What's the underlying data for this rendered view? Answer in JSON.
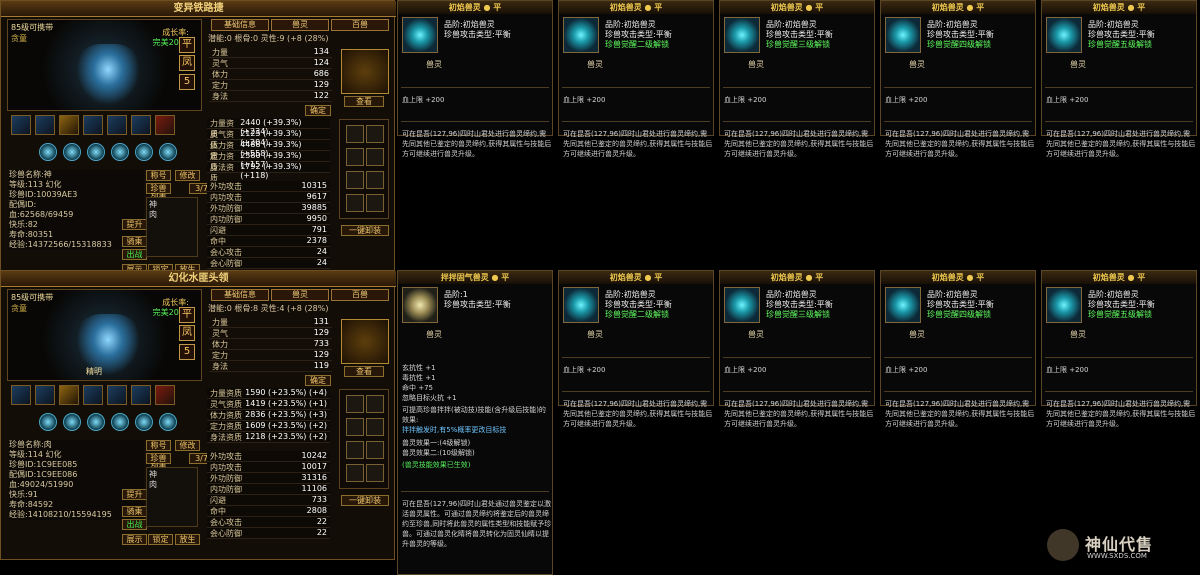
{
  "panels": [
    {
      "title": "变异铁路捷",
      "carry": "85级可携带",
      "carry_sub": "贪童",
      "growth": "成长率:",
      "growth_value": "完美2035",
      "tabs": [
        "基础信息",
        "兽灵",
        "百兽"
      ],
      "nums": {
        "potential": "潜能:0",
        "bone": "根骨:0",
        "soul": "灵性:9",
        "ratio": "(+8 (28%)"
      },
      "stats": [
        [
          "力量",
          134
        ],
        [
          "灵气",
          124
        ],
        [
          "体力",
          686
        ],
        [
          "定力",
          129
        ],
        [
          "身法",
          122
        ]
      ],
      "attrs": [
        [
          "力量资质",
          "2440 (+39.3%)",
          "(+234)"
        ],
        [
          "灵气资质",
          "2125 (+39.3%)",
          "(+204)"
        ],
        [
          "体力资质",
          "4488 (+39.3%)",
          "(+558)"
        ],
        [
          "定力资质",
          "2380 (+39.3%)",
          "(+157)"
        ],
        [
          "身法资质",
          "1792 (+39.3%)",
          "(+118)"
        ]
      ],
      "combat": [
        [
          "外功攻击",
          10315
        ],
        [
          "内功攻击",
          9617
        ],
        [
          "外功防御",
          39885
        ],
        [
          "内功防御",
          9950
        ],
        [
          "闪避",
          791
        ],
        [
          "命中",
          2378
        ],
        [
          "会心攻击",
          24
        ],
        [
          "会心防御",
          24
        ]
      ],
      "name": "神",
      "level": "等级:113",
      "illusion": "幻化",
      "pet_id": "珍兽ID:10039AE3",
      "mate": "配偶ID:",
      "hp": "血:62568/69459",
      "joy": "快乐:82",
      "life": "寿命:80351",
      "exp": "经验:14372566/15318833",
      "buttons": [
        "称号",
        "修改",
        "珍兽列表",
        "3/7",
        "提升",
        "骑乘",
        "展示",
        "锁定",
        "放生",
        "出战",
        "一键卸装",
        "查看",
        "确定"
      ],
      "list": [
        "神",
        "肉"
      ]
    },
    {
      "title": "幻化水匪头领",
      "carry": "85级可携带",
      "carry_sub": "贪童",
      "growth": "成长率:",
      "growth_value": "完美2035",
      "tabs": [
        "基础信息",
        "兽灵",
        "百兽"
      ],
      "nums": {
        "potential": "潜能:0",
        "bone": "根骨:8",
        "soul": "灵性:4",
        "ratio": "(+8 (28%)"
      },
      "stats": [
        [
          "力量",
          131
        ],
        [
          "灵气",
          129
        ],
        [
          "体力",
          733
        ],
        [
          "定力",
          129
        ],
        [
          "身法",
          119
        ]
      ],
      "attrs": [
        [
          "力量资质",
          "1590 (+23.5%)",
          "(+4)"
        ],
        [
          "灵气资质",
          "1419 (+23.5%)",
          "(+1)"
        ],
        [
          "体力资质",
          "2836 (+23.5%)",
          "(+3)"
        ],
        [
          "定力资质",
          "1609 (+23.5%)",
          "(+2)"
        ],
        [
          "身法资质",
          "1218 (+23.5%)",
          "(+2)"
        ]
      ],
      "combat": [
        [
          "外功攻击",
          10242
        ],
        [
          "内功攻击",
          10017
        ],
        [
          "外功防御",
          31316
        ],
        [
          "内功防御",
          11106
        ],
        [
          "闪避",
          733
        ],
        [
          "命中",
          2808
        ],
        [
          "会心攻击",
          22
        ],
        [
          "会心防御",
          22
        ]
      ],
      "name": "肉",
      "level": "等级:114",
      "illusion": "幻化",
      "pet_id": "珍兽ID:1C9EE085",
      "mate": "配偶ID:1C9EE086",
      "hp": "血:49024/51990",
      "joy": "快乐:91",
      "life": "寿命:84592",
      "exp": "经验:14108210/15594195",
      "buttons": [
        "称号",
        "修改",
        "珍兽列表",
        "3/7",
        "提升",
        "骑乘",
        "展示",
        "锁定",
        "放生",
        "出战",
        "一键卸装",
        "查看",
        "确定"
      ],
      "list": [
        "神",
        "肉"
      ],
      "mood": "精明"
    }
  ],
  "tooltips": [
    {
      "title": "初焰兽灵",
      "rank": "品阶:初焰兽灵",
      "type": "珍兽攻击类型:平衡",
      "unlock": "",
      "hp": "血上限 +200"
    },
    {
      "title": "初焰兽灵",
      "rank": "品阶:初焰兽灵",
      "type": "珍兽攻击类型:平衡",
      "unlock": "珍兽觉醒二级解锁",
      "hp": "血上限 +200"
    },
    {
      "title": "初焰兽灵",
      "rank": "品阶:初焰兽灵",
      "type": "珍兽攻击类型:平衡",
      "unlock": "珍兽觉醒三级解锁",
      "hp": "血上限 +200"
    },
    {
      "title": "初焰兽灵",
      "rank": "品阶:初焰兽灵",
      "type": "珍兽攻击类型:平衡",
      "unlock": "珍兽觉醒四级解锁",
      "hp": "血上限 +200"
    },
    {
      "title": "初焰兽灵",
      "rank": "品阶:初焰兽灵",
      "type": "珍兽攻击类型:平衡",
      "unlock": "珍兽觉醒五级解锁",
      "hp": "血上限 +200"
    },
    {
      "title": "拌拌固气兽灵",
      "rank": "品阶:1",
      "type": "珍兽攻击类型:平衡",
      "unlock": "",
      "hp": "玄抗性 +1\n毒抗性 +1\n命中 +75\n忽略目标火抗 +1",
      "special": true
    },
    {
      "title": "初焰兽灵",
      "rank": "品阶:初焰兽灵",
      "type": "珍兽攻击类型:平衡",
      "unlock": "珍兽觉醒二级解锁",
      "hp": "血上限 +200"
    },
    {
      "title": "初焰兽灵",
      "rank": "品阶:初焰兽灵",
      "type": "珍兽攻击类型:平衡",
      "unlock": "珍兽觉醒三级解锁",
      "hp": "血上限 +200"
    },
    {
      "title": "初焰兽灵",
      "rank": "品阶:初焰兽灵",
      "type": "珍兽攻击类型:平衡",
      "unlock": "珍兽觉醒四级解锁",
      "hp": "血上限 +200"
    },
    {
      "title": "初焰兽灵",
      "rank": "品阶:初焰兽灵",
      "type": "珍兽攻击类型:平衡",
      "unlock": "珍兽觉醒五级解锁",
      "hp": "血上限 +200"
    }
  ],
  "desc": "可在昆吾(127,96)四时山君处进行兽灵缔约,需先同其他已鉴定的兽灵缔约,获得其属性与技能后方可继续进行兽灵升级。",
  "desc_special": "可在昆吾(127,96)四时山君处通过兽灵鉴定以激活兽灵属性。可通过兽灵缔约将鉴定后的兽灵缔约至珍兽,同时将此兽灵的属性类型和技能赋予珍兽。可通过兽灵化睛将兽灵转化为固灵仙睛以提升兽灵的等级。",
  "type_label": "兽灵",
  "watermark": "神仙代售",
  "watermark_url": "WWW.SXDS.COM"
}
